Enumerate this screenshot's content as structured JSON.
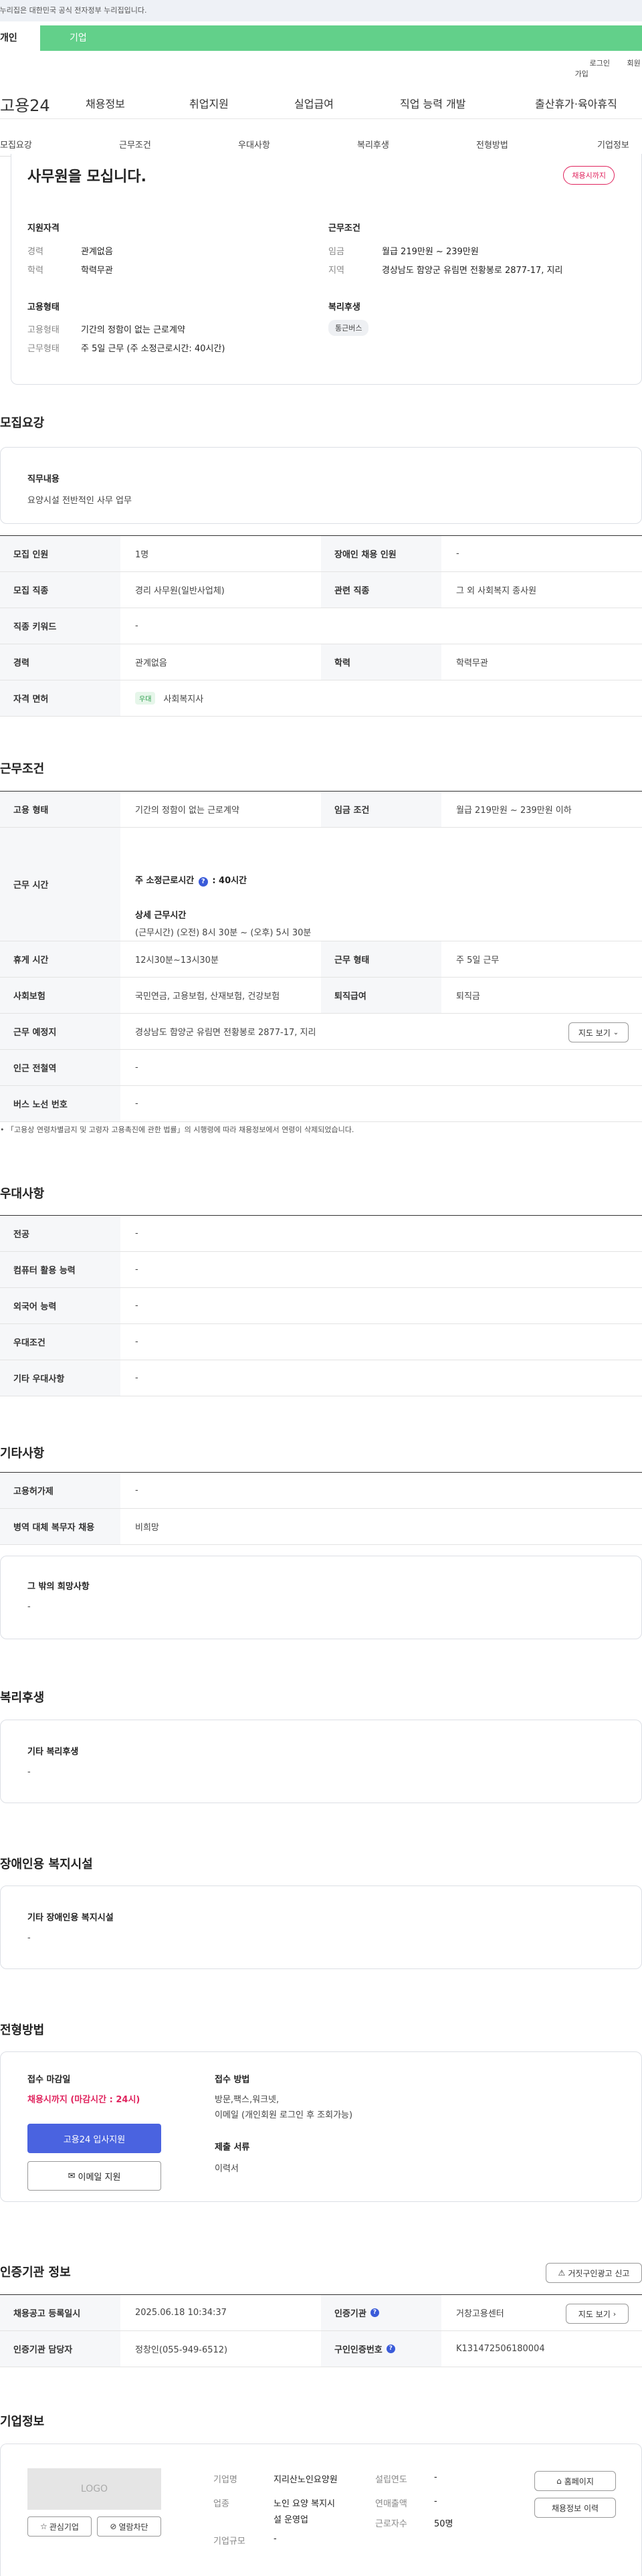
{
  "banner": "이 누리집은 대한민국 공식 전자정부 누리집입니다.",
  "tabs": {
    "personal": "개인",
    "company": "기업"
  },
  "util": {
    "login": "로그인",
    "join": "회원가입"
  },
  "gnb": {
    "logo": "고용24",
    "items": [
      "채용정보",
      "취업지원",
      "실업급여",
      "직업 능력 개발",
      "출산휴가·육아휴직"
    ]
  },
  "subnav": [
    "모집요강",
    "근무조건",
    "우대사항",
    "복리후생",
    "전형방법",
    "기업정보"
  ],
  "summary": {
    "title": "사무원을 모십니다.",
    "deadline_badge": "채용시까지",
    "qual_title": "지원자격",
    "career_label": "경력",
    "career": "관계없음",
    "edu_label": "학력",
    "edu": "학력무관",
    "cond_title": "근무조건",
    "pay_label": "임금",
    "pay": "월급 219만원 ~ 239만원",
    "region_label": "지역",
    "region": "경상남도 함양군 유림면 전황봉로 2877-17, 지리",
    "emp_title": "고용형태",
    "emp_label": "고용형태",
    "emp": "기간의 정함이 없는 근로계약",
    "hours_label": "근무형태",
    "hours": "주 5일 근무 (주 소정근로시간: 40시간)",
    "welfare_title": "복리후생",
    "welfare_tag": "통근버스"
  },
  "recruit": {
    "title": "모집요강",
    "duty_label": "직무내용",
    "duty": "요양시설 전반적인 사무 업무",
    "rows": [
      {
        "k1": "모집 인원",
        "v1": "1명",
        "k2": "장애인 채용 인원",
        "v2": "-"
      },
      {
        "k1": "모집 직종",
        "v1": "경리 사무원(일반사업체)",
        "k2": "관련 직종",
        "v2": "그 외 사회복지 종사원"
      },
      {
        "k1": "직종 키워드",
        "v1": "-"
      },
      {
        "k1": "경력",
        "v1": "관계없음",
        "k2": "학력",
        "v2": "학력무관"
      },
      {
        "k1": "자격 면허",
        "tag": "우대",
        "v1": "사회복지사"
      }
    ]
  },
  "conditions": {
    "title": "근무조건",
    "emp_k": "고용 형태",
    "emp_v": "기간의 정함이 없는 근로계약",
    "pay_k": "임금 조건",
    "pay_v": "월급 219만원 ~ 239만원 이하",
    "time_k": "근무 시간",
    "time_line1": "주 소정근로시간",
    "time_line1b": ": 40시간",
    "time_detail_title": "상세 근무시간",
    "time_detail": "(근무시간) (오전) 8시 30분 ~ (오후) 5시 30분",
    "rest_k": "휴게 시간",
    "rest_v": "12시30분~13시30분",
    "form_k": "근무 형태",
    "form_v": "주 5일 근무",
    "ins_k": "사회보험",
    "ins_v": "국민연금, 고용보험, 산재보험, 건강보험",
    "ret_k": "퇴직급여",
    "ret_v": "퇴직금",
    "place_k": "근무 예정지",
    "place_v": "경상남도 함양군 유림면 전황봉로 2877-17, 지리",
    "map_btn": "지도 보기",
    "sub_k": "인근 전철역",
    "sub_v": "-",
    "bus_k": "버스 노선 번호",
    "bus_v": "-",
    "note": "「고용상 연령차별금지 및 고령자 고용촉진에 관한 법률」의 시행령에 따라 채용정보에서 연령이 삭제되었습니다."
  },
  "pref": {
    "title": "우대사항",
    "rows": [
      {
        "k": "전공",
        "v": "-"
      },
      {
        "k": "컴퓨터 활용 능력",
        "v": "-"
      },
      {
        "k": "외국어 능력",
        "v": "-"
      },
      {
        "k": "우대조건",
        "v": "-"
      },
      {
        "k": "기타 우대사항",
        "v": "-"
      }
    ]
  },
  "etc": {
    "title": "기타사항",
    "rows": [
      {
        "k": "고용허가제",
        "v": "-"
      },
      {
        "k": "병역 대체 복무자 채용",
        "v": "비희망"
      }
    ],
    "other_title": "그 밖의 희망사항",
    "other": "-"
  },
  "welfare": {
    "title": "복리후생",
    "label": "기타 복리후생",
    "value": "-"
  },
  "disabled": {
    "title": "장애인용 복지시설",
    "label": "기타 장애인용 복지시설",
    "value": "-"
  },
  "process": {
    "title": "전형방법",
    "deadline_label": "접수 마감일",
    "deadline": "채용시까지 (마감시간 : 24시)",
    "apply_btn": "고용24 입사지원",
    "email_btn": "이메일 지원",
    "method_label": "접수 방법",
    "method": "방문,팩스,워크넷,",
    "method2": "이메일 (개인회원 로그인 후 조회가능)",
    "docs_label": "제출 서류",
    "docs": "이력서"
  },
  "agency": {
    "title": "인증기관 정보",
    "report_btn": "거짓구인광고 신고",
    "reg_k": "채용공고 등록일시",
    "reg_v": "2025.06.18 10:34:37",
    "cert_k": "인증기관",
    "cert_v": "거창고용센터",
    "map_btn": "지도 보기",
    "mgr_k": "인증기관 담당자",
    "mgr_v": "정창인(055-949-6512)",
    "no_k": "구인인증번호",
    "no_v": "K131472506180004"
  },
  "company": {
    "title": "기업정보",
    "logo": "LOGO",
    "fav_btn": "관심기업",
    "block_btn": "열람차단",
    "name_k": "기업명",
    "name_v": "지리산노인요양원",
    "ind_k": "업종",
    "ind_v1": "노인 요양 복지시",
    "ind_v2": "설 운영업",
    "scale_k": "기업규모",
    "scale_v": "-",
    "year_k": "설립연도",
    "year_v": "-",
    "sales_k": "연매출액",
    "sales_v": "-",
    "emp_k": "근로자수",
    "emp_v": "50명",
    "home_btn": "홈페이지",
    "jobs_btn": "채용정보 이력"
  }
}
